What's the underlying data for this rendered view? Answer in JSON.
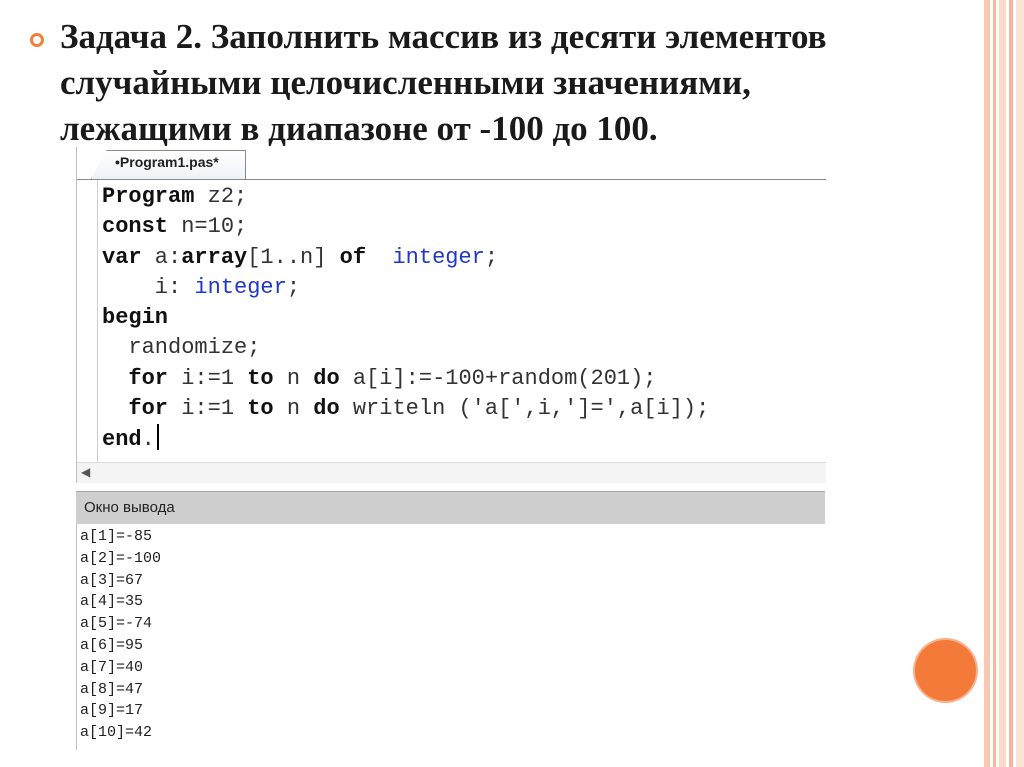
{
  "slide": {
    "title": "Задача 2. Заполнить массив из десяти элементов\nслучайными целочисленными значениями,\nлежащими в диапазоне от -100 до 100."
  },
  "editor": {
    "tab_label": "•Program1.pas*"
  },
  "output": {
    "title": "Окно вывода",
    "lines": [
      "a[1]=-85",
      "a[2]=-100",
      "a[3]=67",
      "a[4]=35",
      "a[5]=-74",
      "a[6]=95",
      "a[7]=40",
      "a[8]=47",
      "a[9]=17",
      "a[10]=42"
    ]
  },
  "colors": {
    "accent": "#f07f3c",
    "keyword": "#111111",
    "type": "#1f38c8"
  },
  "icons": [
    "bullet-icon",
    "scroll-left-arrow-icon",
    "decorative-circle"
  ]
}
